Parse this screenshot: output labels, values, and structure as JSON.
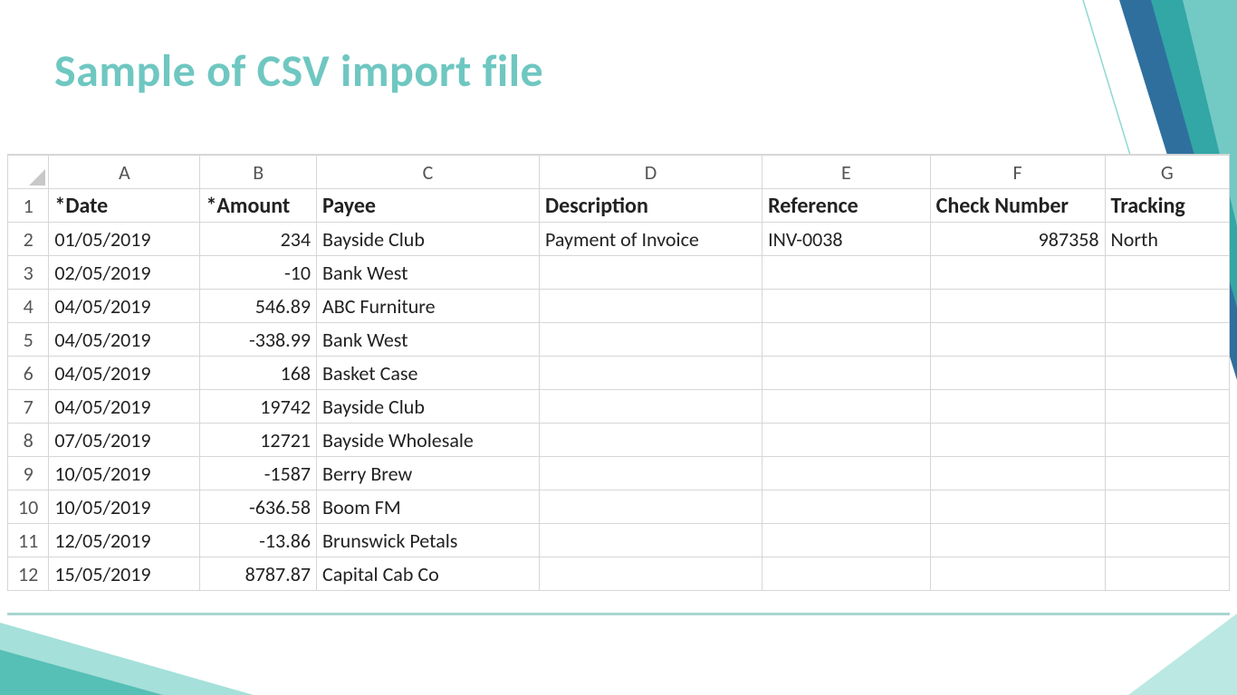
{
  "title": "Sample of CSV import file",
  "columns": [
    "A",
    "B",
    "C",
    "D",
    "E",
    "F",
    "G"
  ],
  "headers": {
    "A": "*Date",
    "B": "*Amount",
    "C": "Payee",
    "D": "Description",
    "E": "Reference",
    "F": "Check Number",
    "G": "Tracking"
  },
  "rows": [
    {
      "n": 2,
      "date": "01/05/2019",
      "amount": "234",
      "payee": "Bayside Club",
      "description": "Payment of Invoice",
      "reference": "INV-0038",
      "check": "987358",
      "tracking": "North"
    },
    {
      "n": 3,
      "date": "02/05/2019",
      "amount": "-10",
      "payee": "Bank West",
      "description": "",
      "reference": "",
      "check": "",
      "tracking": ""
    },
    {
      "n": 4,
      "date": "04/05/2019",
      "amount": "546.89",
      "payee": "ABC Furniture",
      "description": "",
      "reference": "",
      "check": "",
      "tracking": ""
    },
    {
      "n": 5,
      "date": "04/05/2019",
      "amount": "-338.99",
      "payee": "Bank West",
      "description": "",
      "reference": "",
      "check": "",
      "tracking": ""
    },
    {
      "n": 6,
      "date": "04/05/2019",
      "amount": "168",
      "payee": "Basket Case",
      "description": "",
      "reference": "",
      "check": "",
      "tracking": ""
    },
    {
      "n": 7,
      "date": "04/05/2019",
      "amount": "19742",
      "payee": "Bayside Club",
      "description": "",
      "reference": "",
      "check": "",
      "tracking": ""
    },
    {
      "n": 8,
      "date": "07/05/2019",
      "amount": "12721",
      "payee": "Bayside Wholesale",
      "description": "",
      "reference": "",
      "check": "",
      "tracking": ""
    },
    {
      "n": 9,
      "date": "10/05/2019",
      "amount": "-1587",
      "payee": "Berry Brew",
      "description": "",
      "reference": "",
      "check": "",
      "tracking": ""
    },
    {
      "n": 10,
      "date": "10/05/2019",
      "amount": "-636.58",
      "payee": "Boom FM",
      "description": "",
      "reference": "",
      "check": "",
      "tracking": ""
    },
    {
      "n": 11,
      "date": "12/05/2019",
      "amount": "-13.86",
      "payee": "Brunswick Petals",
      "description": "",
      "reference": "",
      "check": "",
      "tracking": ""
    },
    {
      "n": 12,
      "date": "15/05/2019",
      "amount": "8787.87",
      "payee": "Capital Cab Co",
      "description": "",
      "reference": "",
      "check": "",
      "tracking": ""
    }
  ]
}
